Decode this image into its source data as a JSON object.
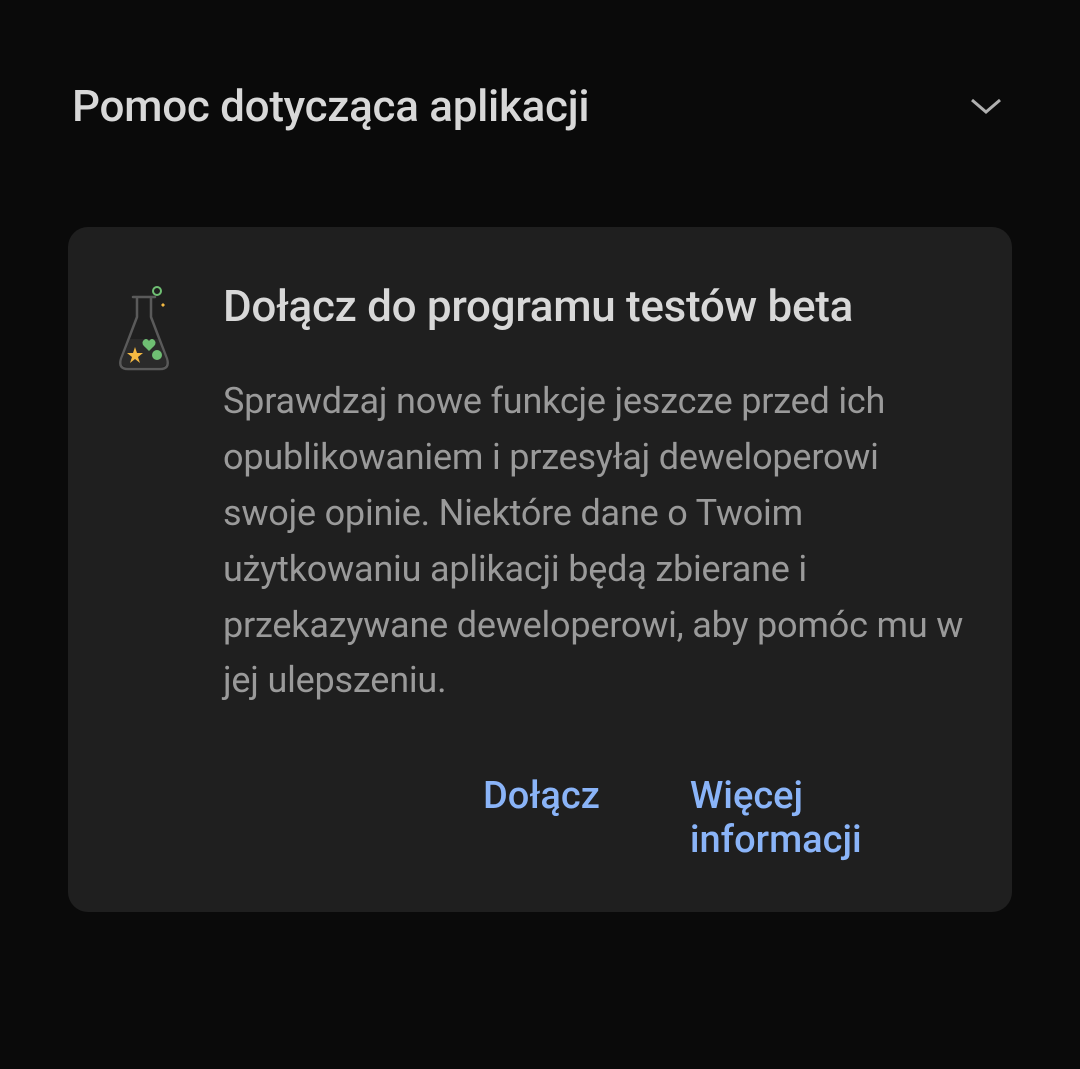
{
  "section": {
    "title": "Pomoc dotycząca aplikacji"
  },
  "betaCard": {
    "title": "Dołącz do programu testów beta",
    "description": "Sprawdzaj nowe funkcje jeszcze przed ich opublikowaniem i przesyłaj deweloperowi swoje opinie. Niektóre dane o Twoim użytkowaniu aplikacji będą zbierane i przekazywane deweloperowi, aby pomóc mu w jej ulepszeniu.",
    "joinLabel": "Dołącz",
    "moreInfoLabel": "Więcej informacji"
  },
  "colors": {
    "background": "#0a0a0a",
    "cardBackground": "#1f1f1f",
    "textPrimary": "#d8d8d8",
    "textSecondary": "#9a9a9a",
    "accent": "#8ab4f8"
  }
}
